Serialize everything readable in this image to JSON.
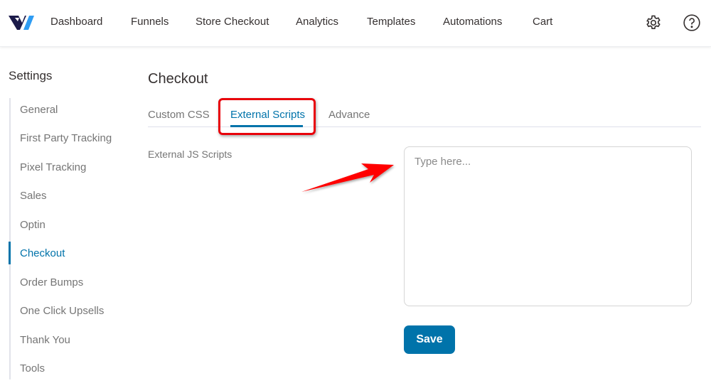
{
  "header": {
    "logo": "vw-logo",
    "nav": [
      "Dashboard",
      "Funnels",
      "Store Checkout",
      "Analytics",
      "Templates",
      "Automations",
      "Cart"
    ],
    "icons": [
      "gear-icon",
      "help-icon"
    ]
  },
  "sidebar": {
    "title": "Settings",
    "items": [
      {
        "label": "General"
      },
      {
        "label": "First Party Tracking"
      },
      {
        "label": "Pixel Tracking"
      },
      {
        "label": "Sales"
      },
      {
        "label": "Optin"
      },
      {
        "label": "Checkout",
        "active": true
      },
      {
        "label": "Order Bumps"
      },
      {
        "label": "One Click Upsells"
      },
      {
        "label": "Thank You"
      },
      {
        "label": "Tools"
      }
    ]
  },
  "main": {
    "title": "Checkout",
    "tabs": [
      {
        "label": "Custom CSS"
      },
      {
        "label": "External Scripts",
        "active": true
      },
      {
        "label": "Advance"
      }
    ],
    "field": {
      "label": "External JS Scripts",
      "value": "",
      "placeholder": "Type here..."
    },
    "save_label": "Save"
  },
  "annotations": {
    "highlight_color": "#e8000a",
    "arrow_color": "#ff0000"
  },
  "colors": {
    "accent": "#0073aa",
    "text": "#353030",
    "muted": "#757575"
  }
}
